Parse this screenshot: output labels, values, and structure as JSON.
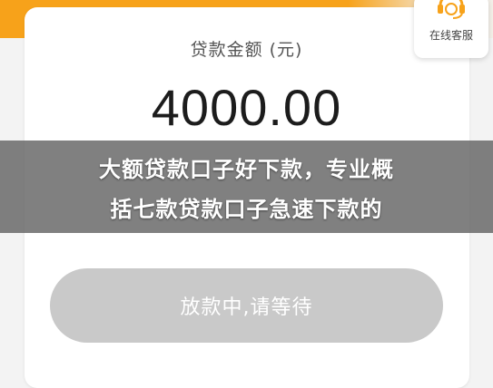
{
  "header": {
    "accent_color": "#f7a21a"
  },
  "customer_service": {
    "label": "在线客服",
    "icon": "headset-icon"
  },
  "loan": {
    "amount_label": "贷款金额 (元)",
    "amount_value": "4000.00"
  },
  "banner": {
    "line1": "大额贷款口子好下款，专业概",
    "line2": "括七款贷款口子急速下款的"
  },
  "action": {
    "status_label": "放款中,请等待"
  }
}
